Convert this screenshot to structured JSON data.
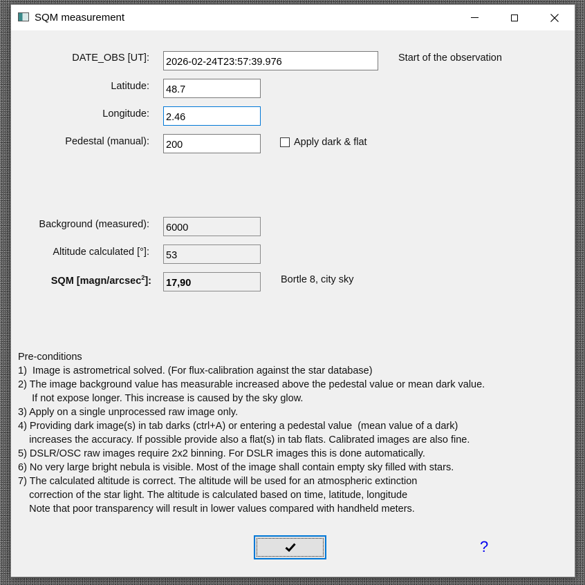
{
  "window": {
    "title": "SQM measurement",
    "controls": {
      "minimize": "minimize",
      "maximize": "maximize",
      "close": "close"
    }
  },
  "form": {
    "date_obs": {
      "label": "DATE_OBS [UT]:",
      "value": "2026-02-24T23:57:39.976",
      "note": "Start of the observation"
    },
    "latitude": {
      "label": "Latitude:",
      "value": "48.7"
    },
    "longitude": {
      "label": "Longitude:",
      "value": "2.46"
    },
    "pedestal": {
      "label": "Pedestal (manual):",
      "value": "200"
    },
    "apply_dark_flat": {
      "label": "Apply dark & flat",
      "checked": false
    },
    "background": {
      "label": "Background (measured):",
      "value": "6000"
    },
    "altitude": {
      "label": "Altitude calculated [°]:",
      "value": "53"
    },
    "sqm": {
      "label_prefix": "SQM [magn/arcsec",
      "label_sup": "2",
      "label_suffix": "]:",
      "value": "17,90",
      "note": "Bortle 8, city sky"
    }
  },
  "preconditions": {
    "heading": "Pre-conditions",
    "lines": [
      "1)  Image is astrometrical solved. (For flux-calibration against the star database)",
      "2) The image background value has measurable increased above the pedestal value or mean dark value.",
      "     If not expose longer. This increase is caused by the sky glow.",
      "3) Apply on a single unprocessed raw image only.",
      "4) Providing dark image(s) in tab darks (ctrl+A) or entering a pedestal value  (mean value of a dark)",
      "    increases the accuracy. If possible provide also a flat(s) in tab flats. Calibrated images are also fine.",
      "5) DSLR/OSC raw images require 2x2 binning. For DSLR images this is done automatically.",
      "6) No very large bright nebula is visible. Most of the image shall contain empty sky filled with stars.",
      "7) The calculated altitude is correct. The altitude will be used for an atmospheric extinction",
      "    correction of the star light. The altitude is calculated based on time, latitude, longitude",
      "    Note that poor transparency will result in lower values compared with handheld meters."
    ]
  },
  "buttons": {
    "ok_icon": "checkmark-icon",
    "help": "?"
  }
}
